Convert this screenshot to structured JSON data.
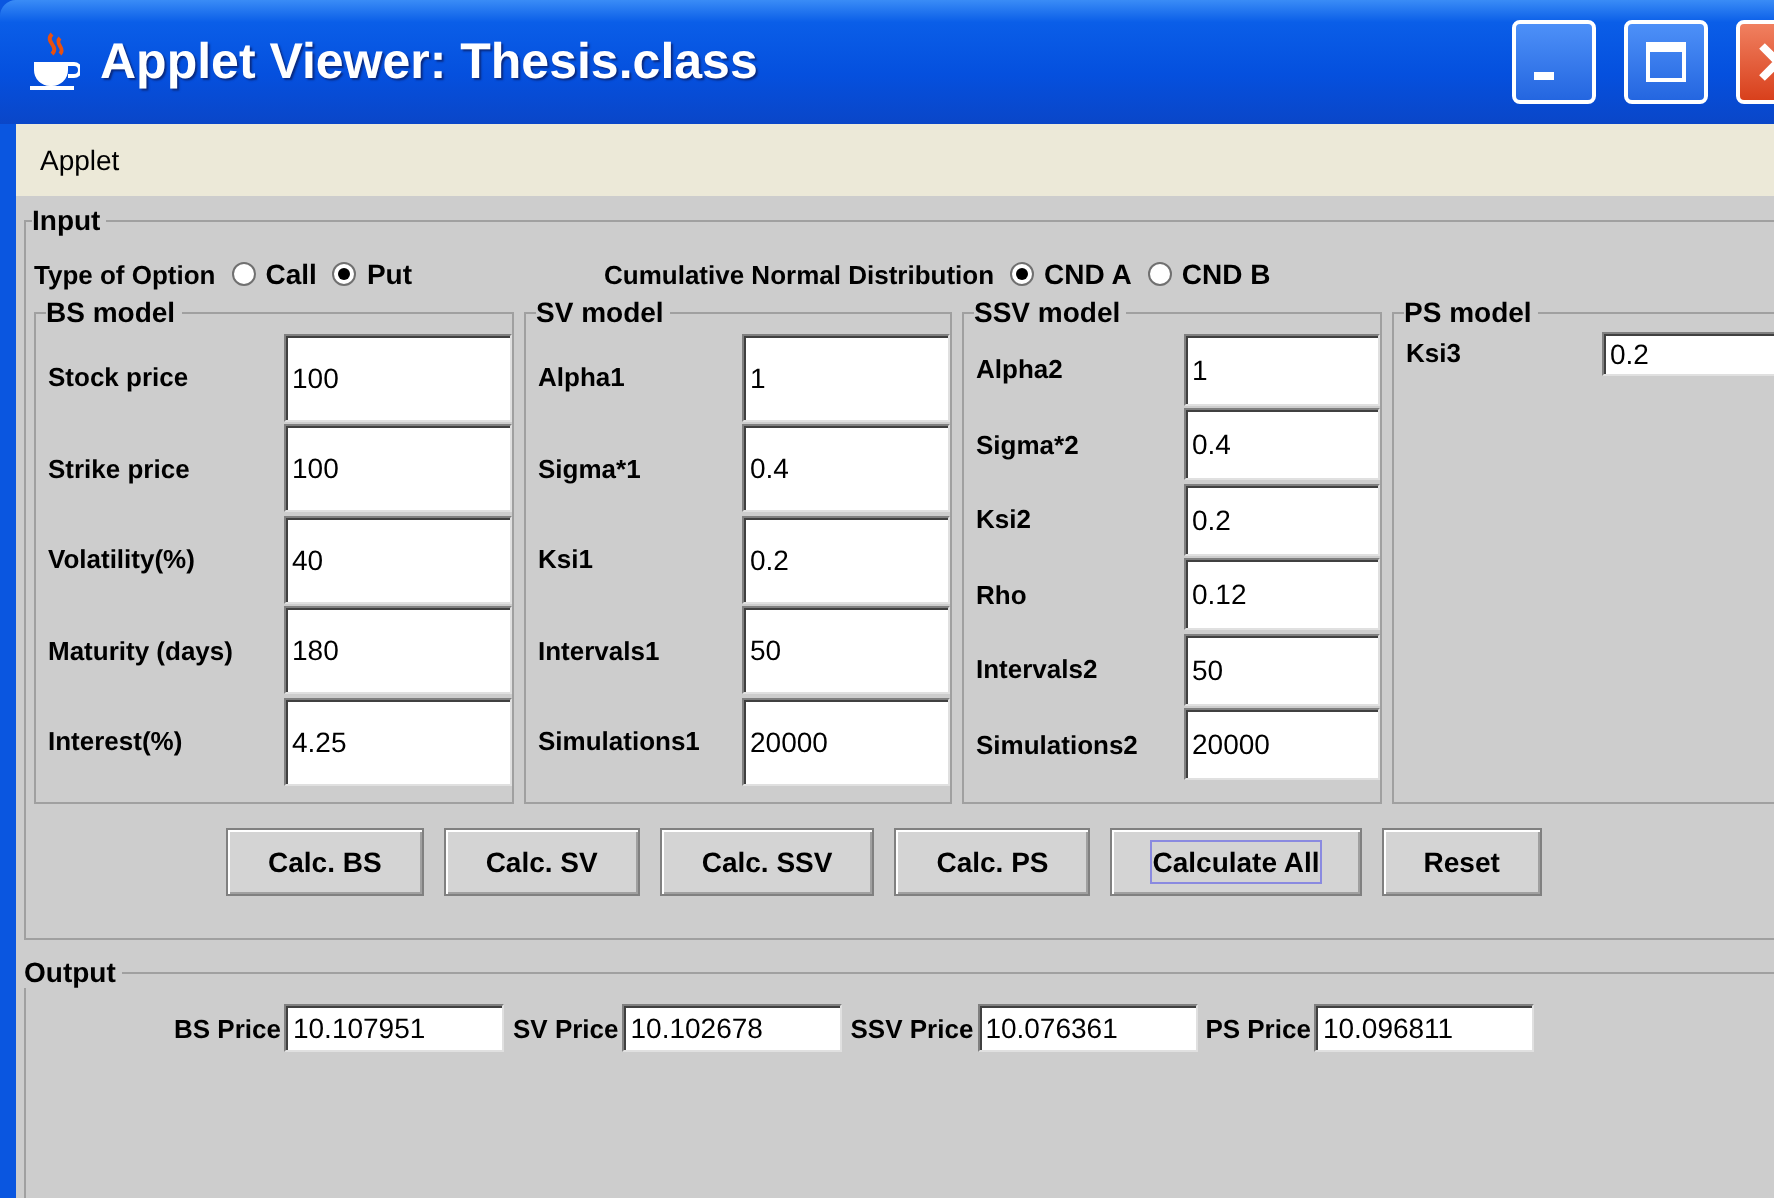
{
  "window": {
    "title": "Applet Viewer: Thesis.class"
  },
  "menu": [
    {
      "label": "Applet"
    }
  ],
  "input": {
    "title": "Input",
    "option_groups": [
      {
        "label": "Type of Option",
        "options": [
          {
            "label": "Call",
            "selected": false
          },
          {
            "label": "Put",
            "selected": true
          }
        ]
      },
      {
        "label": "Cumulative Normal Distribution",
        "options": [
          {
            "label": "CND A",
            "selected": true
          },
          {
            "label": "CND B",
            "selected": false
          }
        ]
      }
    ],
    "models": [
      {
        "title": "BS model",
        "fields": [
          {
            "label": "Stock price",
            "value": "100"
          },
          {
            "label": "Strike price",
            "value": "100"
          },
          {
            "label": "Volatility(%)",
            "value": "40"
          },
          {
            "label": "Maturity (days)",
            "value": "180"
          },
          {
            "label": "Interest(%)",
            "value": "4.25"
          }
        ]
      },
      {
        "title": "SV model",
        "fields": [
          {
            "label": "Alpha1",
            "value": "1"
          },
          {
            "label": "Sigma*1",
            "value": "0.4"
          },
          {
            "label": "Ksi1",
            "value": "0.2"
          },
          {
            "label": "Intervals1",
            "value": "50"
          },
          {
            "label": "Simulations1",
            "value": "20000"
          }
        ]
      },
      {
        "title": "SSV model",
        "fields": [
          {
            "label": "Alpha2",
            "value": "1"
          },
          {
            "label": "Sigma*2",
            "value": "0.4"
          },
          {
            "label": "Ksi2",
            "value": "0.2"
          },
          {
            "label": "Rho",
            "value": "0.12"
          },
          {
            "label": "Intervals2",
            "value": "50"
          },
          {
            "label": "Simulations2",
            "value": "20000"
          }
        ]
      },
      {
        "title": "PS model",
        "fields": [
          {
            "label": "Ksi3",
            "value": "0.2"
          }
        ]
      }
    ],
    "buttons": [
      {
        "label": "Calc. BS",
        "focused": false
      },
      {
        "label": "Calc. SV",
        "focused": false
      },
      {
        "label": "Calc. SSV",
        "focused": false
      },
      {
        "label": "Calc. PS",
        "focused": false
      },
      {
        "label": "Calculate All",
        "focused": true
      },
      {
        "label": "Reset",
        "focused": false
      }
    ]
  },
  "output": {
    "title": "Output",
    "fields": [
      {
        "label": "BS Price",
        "value": "10.107951"
      },
      {
        "label": "SV Price",
        "value": "10.102678"
      },
      {
        "label": "SSV Price",
        "value": "10.076361"
      },
      {
        "label": "PS Price",
        "value": "10.096811"
      }
    ]
  }
}
